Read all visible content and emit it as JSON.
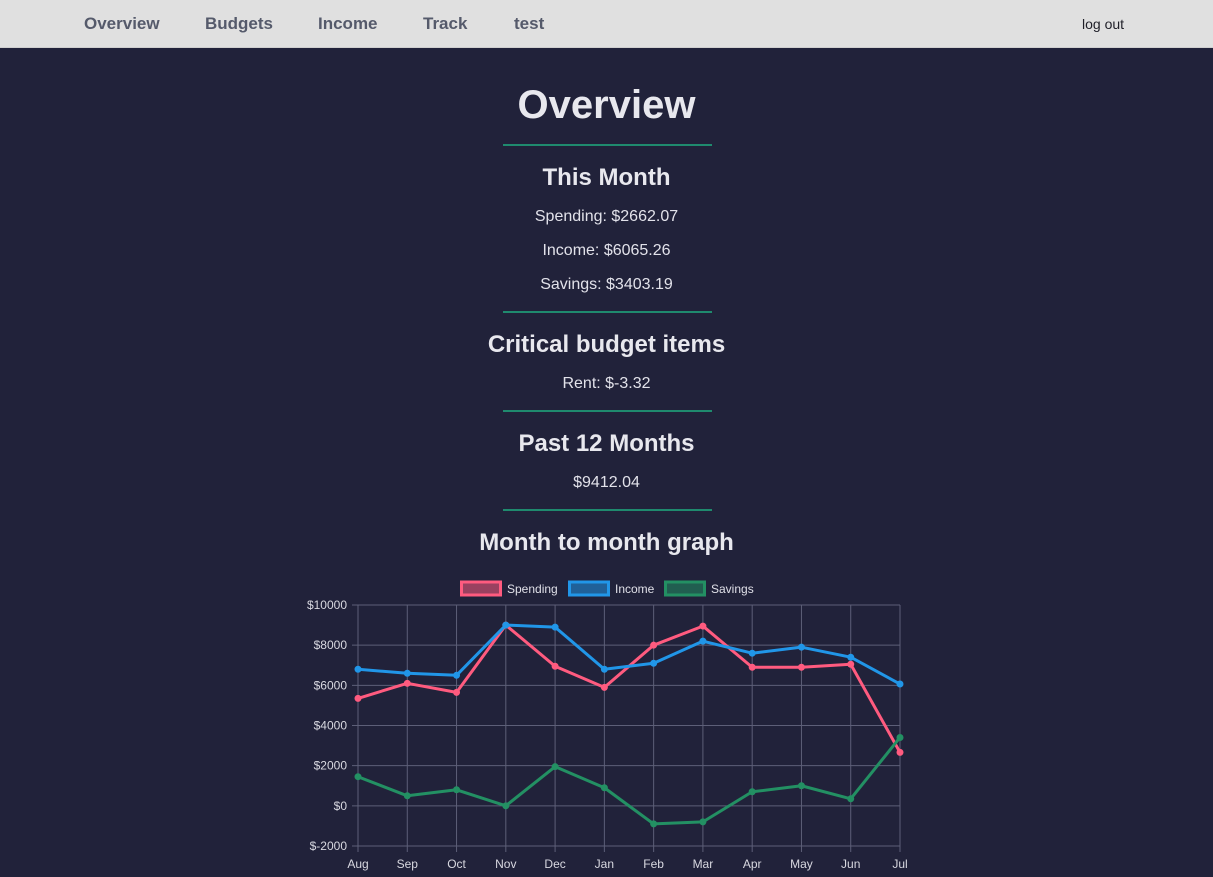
{
  "nav": {
    "items": [
      {
        "label": "Overview"
      },
      {
        "label": "Budgets"
      },
      {
        "label": "Income"
      },
      {
        "label": "Track"
      },
      {
        "label": "test"
      }
    ],
    "logout_label": "log out"
  },
  "page": {
    "title": "Overview",
    "this_month": {
      "title": "This Month",
      "spending": "Spending: $2662.07",
      "income": "Income: $6065.26",
      "savings": "Savings: $3403.19"
    },
    "critical": {
      "title": "Critical budget items",
      "rent": "Rent: $-3.32"
    },
    "past12": {
      "title": "Past 12 Months",
      "total": "$9412.04"
    },
    "graph": {
      "title": "Month to month graph"
    }
  },
  "colors": {
    "spending": "#ff5b7f",
    "income": "#2196e8",
    "savings": "#239063",
    "divider": "#1f8a6e",
    "background": "#21223a",
    "nav_bg": "#e0e0e0"
  },
  "chart_data": {
    "type": "line",
    "categories": [
      "Aug",
      "Sep",
      "Oct",
      "Nov",
      "Dec",
      "Jan",
      "Feb",
      "Mar",
      "Apr",
      "May",
      "Jun",
      "Jul"
    ],
    "series": [
      {
        "name": "Spending",
        "values": [
          5350,
          6100,
          5650,
          9000,
          6950,
          5900,
          8000,
          8950,
          6900,
          6900,
          7050,
          2662
        ]
      },
      {
        "name": "Income",
        "values": [
          6800,
          6600,
          6500,
          9000,
          8900,
          6800,
          7100,
          8200,
          7600,
          7900,
          7400,
          6065
        ]
      },
      {
        "name": "Savings",
        "values": [
          1450,
          500,
          800,
          0,
          1950,
          900,
          -900,
          -800,
          700,
          1000,
          350,
          3403
        ]
      }
    ],
    "ylim": [
      -2000,
      10000
    ],
    "yticks": [
      "$10000",
      "$8000",
      "$6000",
      "$4000",
      "$2000",
      "$0",
      "$-2000"
    ],
    "ytick_values": [
      10000,
      8000,
      6000,
      4000,
      2000,
      0,
      -2000
    ],
    "grid": true,
    "legend": "top"
  }
}
